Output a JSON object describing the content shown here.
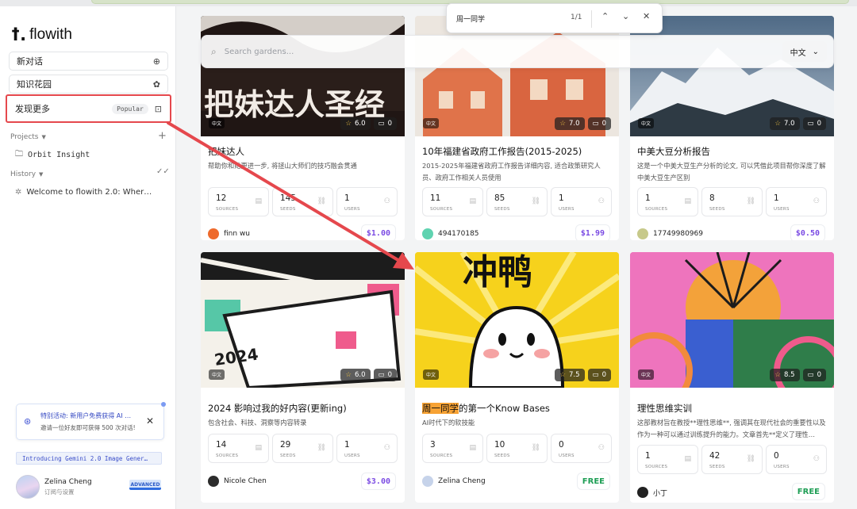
{
  "sidebar": {
    "logo_text": "flowith",
    "nav": {
      "new_chat": "新对话",
      "knowledge_garden": "知识花园",
      "discover_more": "发现更多",
      "discover_tag": "Popular"
    },
    "projects_label": "Projects",
    "project_items": [
      "Orbit Insight"
    ],
    "history_label": "History",
    "history_items": [
      "Welcome to flowith 2.0: Wher…"
    ],
    "promo": {
      "title": "特别活动: 新用户免费获得 AI …",
      "subtitle": "邀请一位好友即可获得 500 次对话!"
    },
    "gemini_banner": "Introducing Gemini 2.0 Image Gener…",
    "user": {
      "name": "Zelina Cheng",
      "subtitle": "订阅与设置",
      "tier": "ADVANCED"
    }
  },
  "search": {
    "placeholder": "Search gardens...",
    "language": "中文"
  },
  "findbar": {
    "query": "周一同学",
    "count": "1/1"
  },
  "colors": {
    "accent_purple": "#7b4be3",
    "free_green": "#1e9e55",
    "highlight_red": "#e5484d",
    "find_highlight": "#f7a234"
  },
  "metric_labels": {
    "sources": "SOURCES",
    "seeds": "SEEDS",
    "users": "USERS"
  },
  "cards": [
    {
      "title": "把妹达人",
      "description": "帮助你和她更进一步, 将拯山大师们的技巧融会贯通",
      "lang_badge": "中文",
      "rating": "6.0",
      "comments": "0",
      "sources": "12",
      "seeds": "145",
      "users": "1",
      "author": "finn wu",
      "price": "$1.00",
      "image_text": "把妹达人圣经"
    },
    {
      "title": "10年福建省政府工作报告(2015-2025)",
      "description": "2015-2025年福建省政府工作报告详细内容, 适合政策研究人员、政府工作相关人员使用",
      "lang_badge": "中文",
      "rating": "7.0",
      "comments": "0",
      "sources": "11",
      "seeds": "85",
      "users": "1",
      "author": "494170185",
      "price": "$1.99"
    },
    {
      "title": "中美大豆分析报告",
      "description": "这是一个中美大豆生产分析的论文, 可以凭借此项目帮你深度了解中美大豆生产区别",
      "lang_badge": "中文",
      "rating": "7.0",
      "comments": "0",
      "sources": "1",
      "seeds": "8",
      "users": "1",
      "author": "17749980969",
      "price": "$0.50"
    },
    {
      "title": "2024 影响过我的好内容(更新ing)",
      "description": "包含社会、科技、洞察等内容转录",
      "lang_badge": "中文",
      "rating": "6.0",
      "comments": "0",
      "sources": "14",
      "seeds": "29",
      "users": "1",
      "author": "Nicole Chen",
      "price": "$3.00",
      "image_text": "2024"
    },
    {
      "title_highlight": "周一同学",
      "title_rest": "的第一个Know Bases",
      "description": "AI时代下的软技能",
      "lang_badge": "中文",
      "rating": "7.5",
      "comments": "0",
      "sources": "3",
      "seeds": "10",
      "users": "0",
      "author": "Zelina Cheng",
      "price": "FREE",
      "image_text": "冲鸭"
    },
    {
      "title": "理性思维实训",
      "description": "这部教材旨在教授**理性思维**, 强调其在现代社会的重要性以及作为一种可以通过训练提升的能力。文章首先**定义了理性…",
      "lang_badge": "中文",
      "rating": "8.5",
      "comments": "0",
      "sources": "1",
      "seeds": "42",
      "users": "0",
      "author": "小丁",
      "price": "FREE"
    }
  ]
}
